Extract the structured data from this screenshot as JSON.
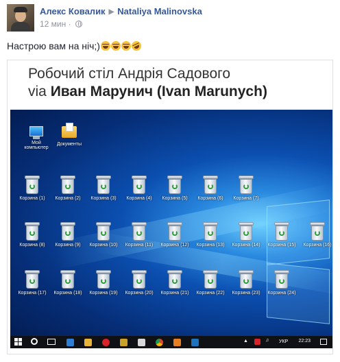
{
  "post": {
    "author": "Алекс Ковалик",
    "recipient": "Nataliya Malinovska",
    "time": "12 мин",
    "separator": "·",
    "text": "Настрою вам на ніч;)"
  },
  "photo": {
    "title_line1": "Робочий стіл Андрія Садового",
    "title_via": "via",
    "title_name": "Иван Марунич (Ivan Marunych)"
  },
  "desktop": {
    "icons": [
      {
        "label": "Мой компьютер"
      },
      {
        "label": "Документы"
      }
    ],
    "bins": [
      "Корзина (1)",
      "Корзина (2)",
      "Корзина (3)",
      "Корзина (4)",
      "Корзина (5)",
      "Корзина (6)",
      "Корзина (7)",
      "Корзина (8)",
      "Корзина (9)",
      "Корзина (10)",
      "Корзина (11)",
      "Корзина (12)",
      "Корзина (13)",
      "Корзина (14)",
      "Корзина (15)",
      "Корзина (16)",
      "Корзина (17)",
      "Корзина (18)",
      "Корзина (19)",
      "Корзина (20)",
      "Корзина (21)",
      "Корзина (22)",
      "Корзина (23)",
      "Корзина (24)"
    ],
    "bin_icon": "recycle-bin-icon"
  },
  "taskbar": {
    "language": "УКР",
    "time": "22:23"
  },
  "colors": {
    "link": "#365899",
    "meta": "#90949c",
    "taskbar": "#0f1115"
  }
}
